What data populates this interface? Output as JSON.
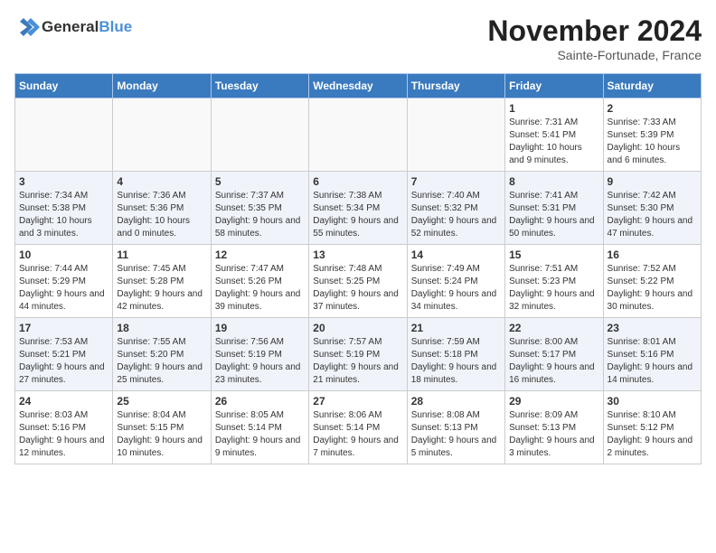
{
  "logo": {
    "text1": "General",
    "text2": "Blue"
  },
  "header": {
    "month": "November 2024",
    "location": "Sainte-Fortunade, France"
  },
  "days_of_week": [
    "Sunday",
    "Monday",
    "Tuesday",
    "Wednesday",
    "Thursday",
    "Friday",
    "Saturday"
  ],
  "weeks": [
    [
      {
        "day": "",
        "info": ""
      },
      {
        "day": "",
        "info": ""
      },
      {
        "day": "",
        "info": ""
      },
      {
        "day": "",
        "info": ""
      },
      {
        "day": "",
        "info": ""
      },
      {
        "day": "1",
        "info": "Sunrise: 7:31 AM\nSunset: 5:41 PM\nDaylight: 10 hours and 9 minutes."
      },
      {
        "day": "2",
        "info": "Sunrise: 7:33 AM\nSunset: 5:39 PM\nDaylight: 10 hours and 6 minutes."
      }
    ],
    [
      {
        "day": "3",
        "info": "Sunrise: 7:34 AM\nSunset: 5:38 PM\nDaylight: 10 hours and 3 minutes."
      },
      {
        "day": "4",
        "info": "Sunrise: 7:36 AM\nSunset: 5:36 PM\nDaylight: 10 hours and 0 minutes."
      },
      {
        "day": "5",
        "info": "Sunrise: 7:37 AM\nSunset: 5:35 PM\nDaylight: 9 hours and 58 minutes."
      },
      {
        "day": "6",
        "info": "Sunrise: 7:38 AM\nSunset: 5:34 PM\nDaylight: 9 hours and 55 minutes."
      },
      {
        "day": "7",
        "info": "Sunrise: 7:40 AM\nSunset: 5:32 PM\nDaylight: 9 hours and 52 minutes."
      },
      {
        "day": "8",
        "info": "Sunrise: 7:41 AM\nSunset: 5:31 PM\nDaylight: 9 hours and 50 minutes."
      },
      {
        "day": "9",
        "info": "Sunrise: 7:42 AM\nSunset: 5:30 PM\nDaylight: 9 hours and 47 minutes."
      }
    ],
    [
      {
        "day": "10",
        "info": "Sunrise: 7:44 AM\nSunset: 5:29 PM\nDaylight: 9 hours and 44 minutes."
      },
      {
        "day": "11",
        "info": "Sunrise: 7:45 AM\nSunset: 5:28 PM\nDaylight: 9 hours and 42 minutes."
      },
      {
        "day": "12",
        "info": "Sunrise: 7:47 AM\nSunset: 5:26 PM\nDaylight: 9 hours and 39 minutes."
      },
      {
        "day": "13",
        "info": "Sunrise: 7:48 AM\nSunset: 5:25 PM\nDaylight: 9 hours and 37 minutes."
      },
      {
        "day": "14",
        "info": "Sunrise: 7:49 AM\nSunset: 5:24 PM\nDaylight: 9 hours and 34 minutes."
      },
      {
        "day": "15",
        "info": "Sunrise: 7:51 AM\nSunset: 5:23 PM\nDaylight: 9 hours and 32 minutes."
      },
      {
        "day": "16",
        "info": "Sunrise: 7:52 AM\nSunset: 5:22 PM\nDaylight: 9 hours and 30 minutes."
      }
    ],
    [
      {
        "day": "17",
        "info": "Sunrise: 7:53 AM\nSunset: 5:21 PM\nDaylight: 9 hours and 27 minutes."
      },
      {
        "day": "18",
        "info": "Sunrise: 7:55 AM\nSunset: 5:20 PM\nDaylight: 9 hours and 25 minutes."
      },
      {
        "day": "19",
        "info": "Sunrise: 7:56 AM\nSunset: 5:19 PM\nDaylight: 9 hours and 23 minutes."
      },
      {
        "day": "20",
        "info": "Sunrise: 7:57 AM\nSunset: 5:19 PM\nDaylight: 9 hours and 21 minutes."
      },
      {
        "day": "21",
        "info": "Sunrise: 7:59 AM\nSunset: 5:18 PM\nDaylight: 9 hours and 18 minutes."
      },
      {
        "day": "22",
        "info": "Sunrise: 8:00 AM\nSunset: 5:17 PM\nDaylight: 9 hours and 16 minutes."
      },
      {
        "day": "23",
        "info": "Sunrise: 8:01 AM\nSunset: 5:16 PM\nDaylight: 9 hours and 14 minutes."
      }
    ],
    [
      {
        "day": "24",
        "info": "Sunrise: 8:03 AM\nSunset: 5:16 PM\nDaylight: 9 hours and 12 minutes."
      },
      {
        "day": "25",
        "info": "Sunrise: 8:04 AM\nSunset: 5:15 PM\nDaylight: 9 hours and 10 minutes."
      },
      {
        "day": "26",
        "info": "Sunrise: 8:05 AM\nSunset: 5:14 PM\nDaylight: 9 hours and 9 minutes."
      },
      {
        "day": "27",
        "info": "Sunrise: 8:06 AM\nSunset: 5:14 PM\nDaylight: 9 hours and 7 minutes."
      },
      {
        "day": "28",
        "info": "Sunrise: 8:08 AM\nSunset: 5:13 PM\nDaylight: 9 hours and 5 minutes."
      },
      {
        "day": "29",
        "info": "Sunrise: 8:09 AM\nSunset: 5:13 PM\nDaylight: 9 hours and 3 minutes."
      },
      {
        "day": "30",
        "info": "Sunrise: 8:10 AM\nSunset: 5:12 PM\nDaylight: 9 hours and 2 minutes."
      }
    ]
  ]
}
